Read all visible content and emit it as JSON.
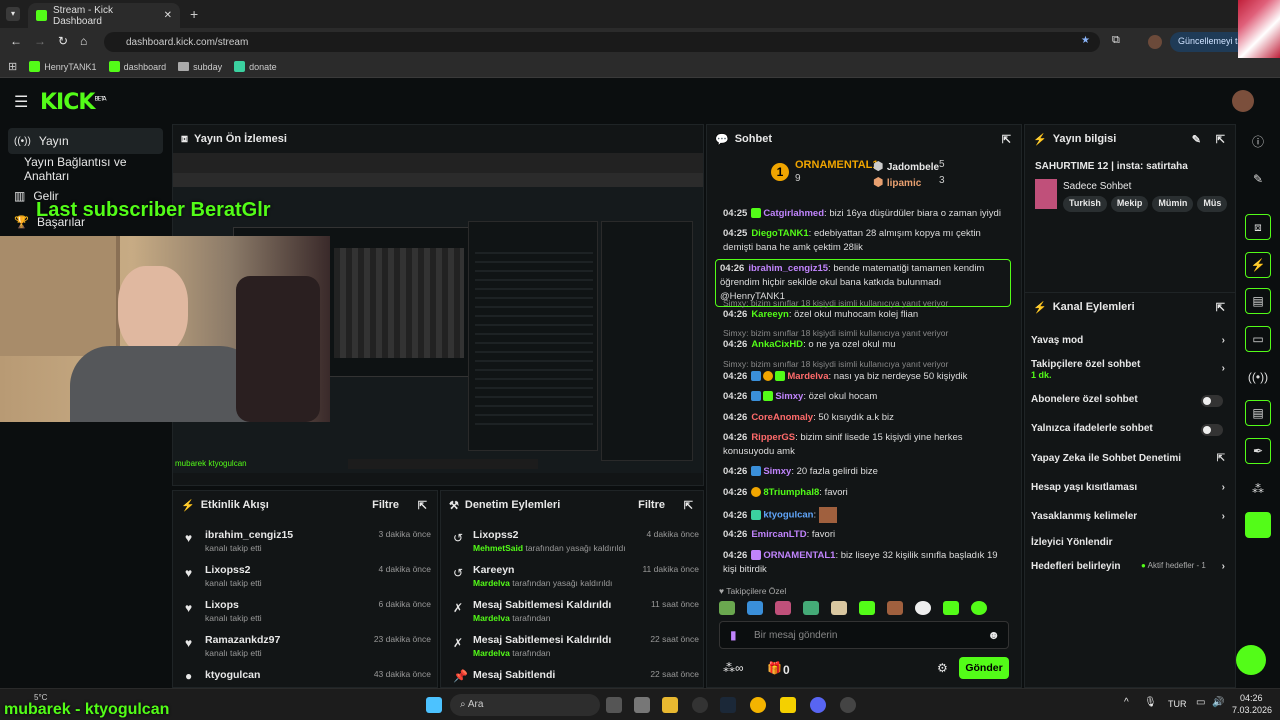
{
  "browser": {
    "tab_title": "Stream - Kick Dashboard",
    "url": "dashboard.kick.com/stream",
    "update_button": "Güncellemeyi tam",
    "bookmarks": [
      "HenryTANK1",
      "dashboard",
      "subday",
      "donate"
    ]
  },
  "header": {
    "logo": "KICK",
    "logo_sup": "BETA"
  },
  "sidebar": {
    "items": [
      {
        "label": "Yayın",
        "icon": "broadcast-icon"
      },
      {
        "label": "Yayın Bağlantısı ve Anahtarı"
      },
      {
        "label": "Gelir",
        "icon": "chart-icon"
      },
      {
        "label": "Başarılar",
        "icon": "trophy-icon"
      }
    ]
  },
  "overlay": {
    "last_subscriber": "Last subscriber BeratGlr",
    "mubarek": "mubarek - ktyogulcan",
    "small_mubarek": "mubarek ktyogulcan"
  },
  "preview": {
    "title": "Yayın Ön İzlemesi"
  },
  "activity": {
    "title": "Etkinlik Akışı",
    "filter": "Filtre",
    "items": [
      {
        "name": "ibrahim_cengiz15",
        "sub": "kanalı takip etti",
        "time": "3 dakika önce"
      },
      {
        "name": "Lixopss2",
        "sub": "kanalı takip etti",
        "time": "4 dakika önce"
      },
      {
        "name": "Lixops",
        "sub": "kanalı takip etti",
        "time": "6 dakika önce"
      },
      {
        "name": "Ramazankdz97",
        "sub": "kanalı takip etti",
        "time": "23 dakika önce"
      },
      {
        "name": "ktyogulcan",
        "sub": "",
        "time": "43 dakika önce"
      }
    ]
  },
  "moderation": {
    "title": "Denetim Eylemleri",
    "filter": "Filtre",
    "items": [
      {
        "name": "Lixopss2",
        "by": "MehmetSaid",
        "action": "tarafından yasağı kaldırıldı",
        "time": "4 dakika önce"
      },
      {
        "name": "Kareeyn",
        "by": "Mardelva",
        "action": "tarafından yasağı kaldırıldı",
        "time": "11 dakika önce"
      },
      {
        "name": "Mesaj Sabitlemesi Kaldırıldı",
        "by": "Mardelva",
        "action": "tarafından",
        "time": "11 saat önce"
      },
      {
        "name": "Mesaj Sabitlemesi Kaldırıldı",
        "by": "Mardelva",
        "action": "tarafından",
        "time": "22 saat önce"
      },
      {
        "name": "Mesaj Sabitlendi",
        "by": "",
        "action": "",
        "time": "22 saat önce"
      }
    ]
  },
  "chat": {
    "title": "Sohbet",
    "top_gifters": [
      {
        "rank": "1",
        "name": "ORNAMENTAL1",
        "count": "9"
      },
      {
        "name": "Jadombele",
        "count": "5"
      },
      {
        "name": "lipamic",
        "count": "3"
      }
    ],
    "messages": [
      {
        "time": "04:25",
        "user": "Catgirlahmed",
        "text": "bizi 16ya düşürdüler biara o zaman iyiydi"
      },
      {
        "time": "04:25",
        "user": "DiegoTANK1",
        "text": "edebiyattan 28 almışım kopya mı çektin demişti bana he amk çektim 28lik"
      },
      {
        "time": "04:26",
        "user": "ibrahim_cengiz15",
        "text": "bende matematiği tamamen kendim öğrendim hiçbir sekilde okul bana katkıda bulunmadı @HenryTANK1"
      },
      {
        "reply": "Simxy: bizim sınıflar 18 kişiydi isimli kullanıcıya yanıt veriyor",
        "time": "04:26",
        "user": "Kareeyn",
        "text": "özel okul muhocam kolej flian"
      },
      {
        "reply": "Simxy: bizim sınıflar 18 kişiydi isimli kullanıcıya yanıt veriyor",
        "time": "04:26",
        "user": "AnkaCixHD",
        "text": "o ne ya ozel okul mu"
      },
      {
        "reply": "Simxy: bizim sınıflar 18 kişiydi isimli kullanıcıya yanıt veriyor",
        "time": "04:26",
        "user": "Mardelva",
        "text": "nası ya biz nerdeyse 50 kişiydik"
      },
      {
        "time": "04:26",
        "user": "Simxy",
        "text": "özel okul hocam"
      },
      {
        "time": "04:26",
        "user": "CoreAnomaly",
        "text": "50 kısıydık a.k biz"
      },
      {
        "time": "04:26",
        "user": "RipperGS",
        "text": "bizim sinif lisede 15 kişiydi yine herkes konusuyodu amk"
      },
      {
        "time": "04:26",
        "user": "Simxy",
        "text": "20 fazla gelirdi bize"
      },
      {
        "time": "04:26",
        "user": "8Triumphal8",
        "text": "favori"
      },
      {
        "time": "04:26",
        "user": "ktyogulcan",
        "text": ""
      },
      {
        "time": "04:26",
        "user": "EmircanLTD",
        "text": "favori"
      },
      {
        "time": "04:26",
        "user": "ORNAMENTAL1",
        "text": "biz liseye 32 kişilik sınıfla başladık 19 kişi bitirdik"
      }
    ],
    "followers_only": "Takipçilere Özel",
    "input_placeholder": "Bir mesaj gönderin",
    "points": "0",
    "send": "Gönder"
  },
  "stream_info": {
    "title": "Yayın bilgisi",
    "stream_title": "SAHURTIME 12 | insta: satirtaha",
    "category": "Sadece Sohbet",
    "tags": [
      "Turkish",
      "Mekip",
      "Mümin",
      "Müs"
    ]
  },
  "channel_actions": {
    "title": "Kanal Eylemleri",
    "slow_mode": "Yavaş mod",
    "followers_chat": "Takipçilere özel sohbet",
    "followers_chat_value": "1 dk.",
    "subscribers_chat": "Abonelere özel sohbet",
    "emotes_chat": "Yalnızca ifadelerle sohbet",
    "ai_moderation": "Yapay Zeka ile Sohbet Denetimi",
    "account_age": "Hesap yaşı kısıtlaması",
    "banned_words": "Yasaklanmış kelimeler",
    "viewer_redirect": "İzleyici Yönlendir",
    "set_goals": "Hedefleri belirleyin",
    "goals_status": "Aktif hedefler - 1"
  },
  "taskbar": {
    "weather": "5°C",
    "search": "Ara",
    "lang": "TUR",
    "time": "04:26",
    "date": "7.03.2026"
  },
  "colors": {
    "accent": "#53fc18",
    "bg": "#0b0e0f",
    "panel": "#121516"
  }
}
